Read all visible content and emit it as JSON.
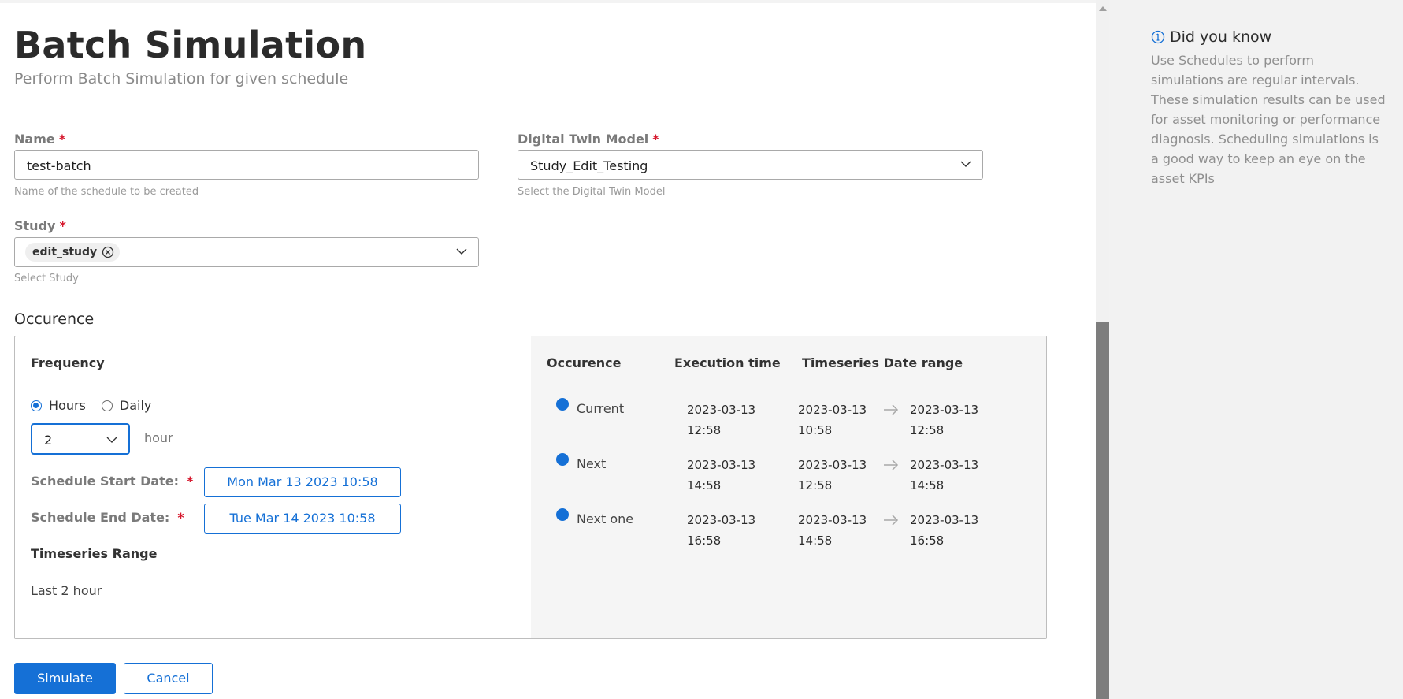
{
  "page": {
    "title": "Batch Simulation",
    "subtitle": "Perform Batch Simulation for given schedule"
  },
  "form": {
    "name": {
      "label": "Name",
      "required": "*",
      "value": "test-batch",
      "hint": "Name of the schedule to be created"
    },
    "model": {
      "label": "Digital Twin Model",
      "required": "*",
      "value": "Study_Edit_Testing",
      "hint": "Select the Digital Twin Model"
    },
    "study": {
      "label": "Study",
      "required": "*",
      "chip": "edit_study",
      "hint": "Select Study"
    }
  },
  "occurrence": {
    "section_title": "Occurence",
    "frequency_title": "Frequency",
    "radio_options": [
      {
        "label": "Hours",
        "selected": true
      },
      {
        "label": "Daily",
        "selected": false
      }
    ],
    "interval_value": "2",
    "interval_unit": "hour",
    "start_label": "Schedule Start Date:",
    "start_value": "Mon Mar 13 2023 10:58",
    "end_label": "Schedule End Date:",
    "end_value": "Tue Mar 14 2023 10:58",
    "required": "*",
    "timeseries_title": "Timeseries Range",
    "timeseries_value": "Last 2 hour",
    "table": {
      "headers": [
        "Occurence",
        "Execution time",
        "Timeseries Date range"
      ],
      "rows": [
        {
          "name": "Current",
          "exec_date": "2023-03-13",
          "exec_time": "12:58",
          "from_date": "2023-03-13",
          "from_time": "10:58",
          "to_date": "2023-03-13",
          "to_time": "12:58"
        },
        {
          "name": "Next",
          "exec_date": "2023-03-13",
          "exec_time": "14:58",
          "from_date": "2023-03-13",
          "from_time": "12:58",
          "to_date": "2023-03-13",
          "to_time": "14:58"
        },
        {
          "name": "Next one",
          "exec_date": "2023-03-13",
          "exec_time": "16:58",
          "from_date": "2023-03-13",
          "from_time": "14:58",
          "to_date": "2023-03-13",
          "to_time": "16:58"
        }
      ]
    }
  },
  "actions": {
    "simulate": "Simulate",
    "cancel": "Cancel"
  },
  "aside": {
    "title": "Did you know",
    "text": "Use Schedules to perform simulations are regular intervals. These simulation results can be used for asset monitoring or performance diagnosis. Scheduling simulations is a good way to keep an eye on the asset KPIs"
  },
  "icons": {
    "chevron": "chevron-down-icon",
    "chip_remove": "remove-circle-icon",
    "arrow": "arrow-right-icon",
    "info": "info-icon"
  },
  "colors": {
    "accent": "#1570d6",
    "required": "#d6182d"
  }
}
